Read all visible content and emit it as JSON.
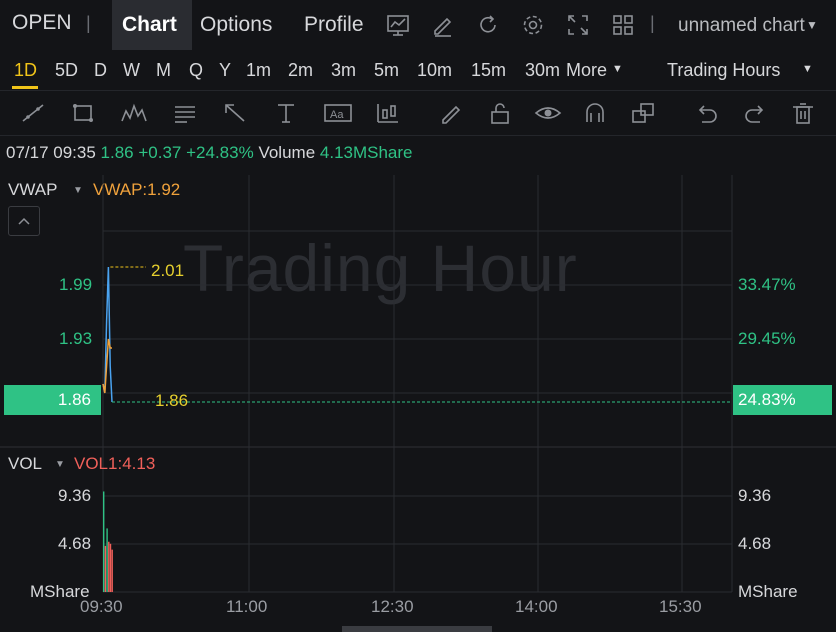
{
  "topnav": {
    "open_label": "OPEN",
    "separator": "|",
    "tabs": [
      "Chart",
      "Options",
      "Profile"
    ],
    "chart_name": "unnamed chart",
    "icons": [
      "chart-icon",
      "edit-icon",
      "refresh-icon",
      "settings-icon",
      "fullscreen-icon",
      "layout-icon"
    ]
  },
  "intervals": {
    "items": [
      "1D",
      "5D",
      "D",
      "W",
      "M",
      "Q",
      "Y",
      "1m",
      "2m",
      "3m",
      "5m",
      "10m",
      "15m",
      "30m"
    ],
    "active": "1D",
    "more_label": "More",
    "session_label": "Trading Hours"
  },
  "toolbar": {
    "icons": [
      "trend-line-icon",
      "rectangle-icon",
      "pattern-icon",
      "text-note-icon",
      "arrow-icon",
      "measure-icon",
      "text-icon",
      "chart-type-icon",
      "pencil-icon",
      "lock-icon",
      "eye-icon",
      "magnet-icon",
      "layers-icon",
      "undo-icon",
      "redo-icon",
      "trash-icon"
    ]
  },
  "info": {
    "datetime": "07/17 09:35",
    "price": "1.86",
    "change": "+0.37",
    "change_pct": "+24.83%",
    "volume_label": "Volume",
    "volume_value": "4.13MShare"
  },
  "price_panel": {
    "indicator": "VWAP",
    "indicator_value": "VWAP:1.92",
    "watermark": "Trading Hour",
    "left_axis": [
      "1.99",
      "1.93"
    ],
    "right_axis": [
      "33.47%",
      "29.45%"
    ],
    "current_price_tag": "1.86",
    "current_pct_tag": "24.83%",
    "high_marker": "2.01",
    "last_marker": "1.86"
  },
  "volume_panel": {
    "indicator": "VOL",
    "indicator_value": "VOL1:4.13",
    "left_axis": [
      "9.36",
      "4.68",
      "MShare"
    ],
    "right_axis": [
      "9.36",
      "4.68",
      "MShare"
    ]
  },
  "time_axis": [
    "09:30",
    "11:00",
    "12:30",
    "14:00",
    "15:30"
  ],
  "colors": {
    "up": "#2fc285",
    "vwap": "#f0a23c",
    "price_line": "#4aa3f0",
    "active": "#f0c419",
    "down": "#f0605a"
  },
  "chart_data": {
    "type": "line",
    "x": [
      "09:30",
      "09:31",
      "09:32",
      "09:33",
      "09:34",
      "09:35"
    ],
    "series": [
      {
        "values": [
          1.88,
          1.87,
          1.95,
          2.01,
          1.9,
          1.86
        ]
      },
      {
        "name": "VWAP",
        "values": [
          1.88,
          1.87,
          1.9,
          1.93,
          1.92,
          1.92
        ]
      }
    ],
    "volume": {
      "name": "VOL1",
      "values": [
        9.8,
        4.5,
        6.2,
        4.9,
        4.7,
        4.13
      ]
    },
    "ylim": [
      1.84,
      2.04
    ]
  }
}
